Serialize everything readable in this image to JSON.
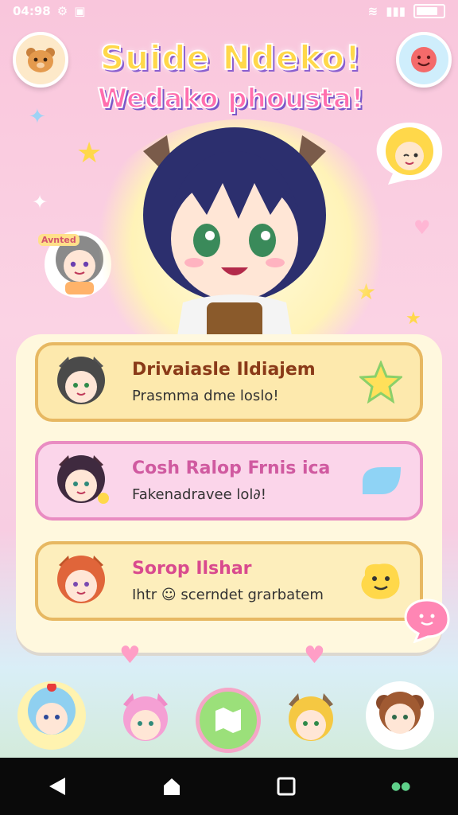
{
  "status_bar": {
    "time": "04:98",
    "icons": [
      "settings-icon",
      "notification-icon",
      "wifi-icon",
      "signal-icon",
      "battery-icon"
    ]
  },
  "header": {
    "title_line1": "Suide Ndeko!",
    "title_line2": "Wedako phousta!",
    "left_button_icon": "bear-icon",
    "right_button_icon": "smiley-icon"
  },
  "cards": [
    {
      "title": "Drivaiasle Ildiajem",
      "subtitle": "Prasmma dme loslo!",
      "badge_icon": "star-icon"
    },
    {
      "title": "Cosh Ralop Frnis ica",
      "subtitle": "Fakenadravee lol∂!",
      "badge_icon": "bubble-icon"
    },
    {
      "title": "Sorop Ilshar",
      "subtitle": "Ihtr ☺ scerndet grarbatem",
      "badge_icon": "blob-face-icon"
    }
  ],
  "side_labels": {
    "chibi_tag": "Avnted"
  },
  "navbar": {
    "items": [
      "back-icon",
      "home-icon",
      "recents-icon"
    ]
  },
  "colors": {
    "pink": "#fbd3e4",
    "gold": "#e7b862",
    "accent_pink": "#e98cc2",
    "green": "#9be07a"
  }
}
